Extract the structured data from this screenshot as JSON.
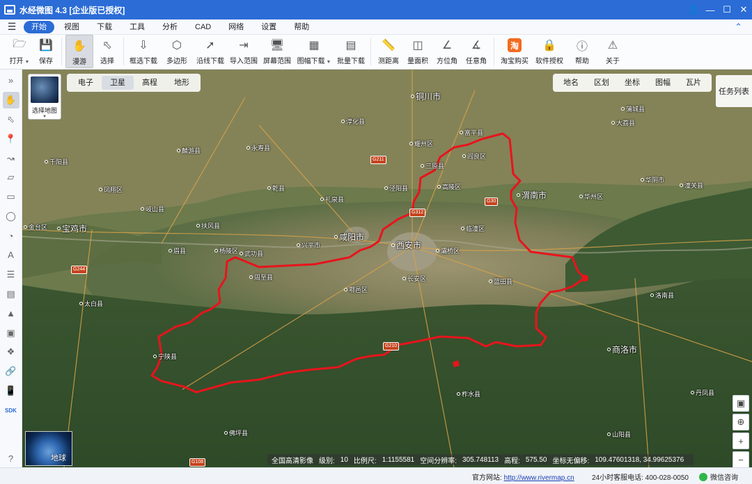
{
  "window": {
    "title": "水经微图 4.3 [企业版已授权]",
    "controls": [
      "user-icon",
      "minimize-icon",
      "maximize-icon",
      "close-icon"
    ]
  },
  "menu": {
    "items": [
      "开始",
      "视图",
      "下载",
      "工具",
      "分析",
      "CAD",
      "网络",
      "设置",
      "帮助"
    ],
    "active": "开始"
  },
  "toolbar": {
    "tools": [
      {
        "label": "打开",
        "icon": "folder-icon",
        "dropdown": true
      },
      {
        "label": "保存",
        "icon": "save-icon"
      },
      {
        "label": "漫游",
        "icon": "hand-icon",
        "selected": true
      },
      {
        "label": "选择",
        "icon": "pointer-icon"
      },
      {
        "label": "框选下载",
        "icon": "rect-download-icon"
      },
      {
        "label": "多边形",
        "icon": "polygon-download-icon"
      },
      {
        "label": "沿线下载",
        "icon": "line-download-icon"
      },
      {
        "label": "导入范围",
        "icon": "import-range-icon"
      },
      {
        "label": "屏幕范围",
        "icon": "screen-range-icon"
      },
      {
        "label": "图幅下载",
        "icon": "sheet-download-icon",
        "dropdown": true
      },
      {
        "label": "批量下载",
        "icon": "batch-download-icon"
      },
      {
        "label": "测距离",
        "icon": "ruler-icon"
      },
      {
        "label": "量面积",
        "icon": "area-icon"
      },
      {
        "label": "方位角",
        "icon": "azimuth-icon"
      },
      {
        "label": "任意角",
        "icon": "angle-icon"
      },
      {
        "label": "淘宝购买",
        "icon": "taobao-icon"
      },
      {
        "label": "软件授权",
        "icon": "lock-icon"
      },
      {
        "label": "帮助",
        "icon": "help-icon"
      },
      {
        "label": "关于",
        "icon": "info-icon"
      }
    ]
  },
  "map": {
    "basemap_label": "选择地图",
    "map_types": [
      "电子",
      "卫星",
      "高程",
      "地形"
    ],
    "active_map_type": "卫星",
    "layers": [
      "地名",
      "区划",
      "坐标",
      "图幅",
      "瓦片"
    ],
    "task_list": "任务列表",
    "globe_label": "地球",
    "places": [
      {
        "name": "铜川市",
        "kind": "city"
      },
      {
        "name": "咸阳市",
        "kind": "city"
      },
      {
        "name": "西安市",
        "kind": "city"
      },
      {
        "name": "宝鸡市",
        "kind": "city"
      },
      {
        "name": "渭南市",
        "kind": "city"
      },
      {
        "name": "商洛市",
        "kind": "city"
      },
      {
        "name": "三原县"
      },
      {
        "name": "泾阳县"
      },
      {
        "name": "高陵区"
      },
      {
        "name": "阎良区"
      },
      {
        "name": "富平县"
      },
      {
        "name": "临潼区"
      },
      {
        "name": "灞桥区"
      },
      {
        "name": "长安区"
      },
      {
        "name": "鄠邑区"
      },
      {
        "name": "周至县"
      },
      {
        "name": "蓝田县"
      },
      {
        "name": "兴平市"
      },
      {
        "name": "武功县"
      },
      {
        "name": "杨陵区"
      },
      {
        "name": "扶风县"
      },
      {
        "name": "眉县"
      },
      {
        "name": "岐山县"
      },
      {
        "name": "凤翔区"
      },
      {
        "name": "乾县"
      },
      {
        "name": "礼泉县"
      },
      {
        "name": "永寿县"
      },
      {
        "name": "淳化县"
      },
      {
        "name": "耀州区"
      },
      {
        "name": "华州区"
      },
      {
        "name": "华阴市"
      },
      {
        "name": "大荔县"
      },
      {
        "name": "洛南县"
      },
      {
        "name": "柞水县"
      },
      {
        "name": "宁陕县"
      },
      {
        "name": "太白县"
      },
      {
        "name": "佛坪县"
      },
      {
        "name": "山阳县"
      },
      {
        "name": "丹凤县"
      },
      {
        "name": "麟游县"
      },
      {
        "name": "千阳县"
      },
      {
        "name": "金台区"
      },
      {
        "name": "蒲城县"
      },
      {
        "name": "潼关县"
      }
    ],
    "roads": [
      "G211",
      "G312",
      "G30",
      "G244",
      "G210",
      "G108"
    ]
  },
  "status": {
    "source": "全国高清影像",
    "level_label": "级别:",
    "level": "10",
    "scale_label": "比例尺:",
    "scale": "1:1155581",
    "resolution_label": "空间分辨率:",
    "resolution": "305.748113",
    "elevation_label": "高程:",
    "elevation": "575.50",
    "coord_label": "坐标无偏移:",
    "coord": "109.47601318, 34.99625376"
  },
  "footer": {
    "website_label": "官方网站:",
    "website": "http://www.rivermap.cn",
    "hotline": "24小时客服电话: 400-028-0050",
    "wechat": "微信咨询"
  },
  "colors": {
    "titlebar": "#2b6cd6",
    "boundary": "#e8141c",
    "terrain_green": "#3e5a34",
    "plain_tan": "#8c8a62"
  }
}
